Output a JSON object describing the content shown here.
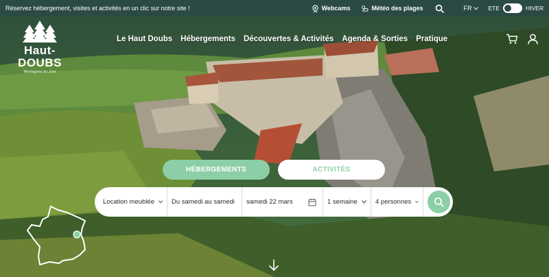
{
  "colors": {
    "topbar": "#2b4a45",
    "accent": "#8ccfa6",
    "white": "#ffffff"
  },
  "topbar": {
    "promo": "Réservez hébergement, visites et activités en un clic sur notre site !",
    "webcams": "Webcams",
    "meteo": "Météo des plages",
    "language": "FR",
    "season_left": "ETE",
    "season_right": "HIVER"
  },
  "logo": {
    "brand": "Haut-DOUBS",
    "tagline": "Montagnes du Jura"
  },
  "nav": {
    "items": [
      "Le Haut Doubs",
      "Hébergements",
      "Découvertes & Activités",
      "Agenda & Sorties",
      "Pratique"
    ]
  },
  "icons": {
    "webcam": "webcam-icon",
    "weather": "weather-icon",
    "search": "search-icon",
    "cart": "cart-icon",
    "user": "user-icon",
    "calendar": "calendar-icon",
    "scroll": "arrow-down-icon"
  },
  "tabs": {
    "hebergements": "HÉBERGEMENTS",
    "activites": "ACTIVITÉS"
  },
  "search": {
    "type": "Location meublée",
    "period": "Du samedi au samedi",
    "date": "samedi 22 mars",
    "duration": "1 semaine",
    "guests": "4 personnes"
  }
}
